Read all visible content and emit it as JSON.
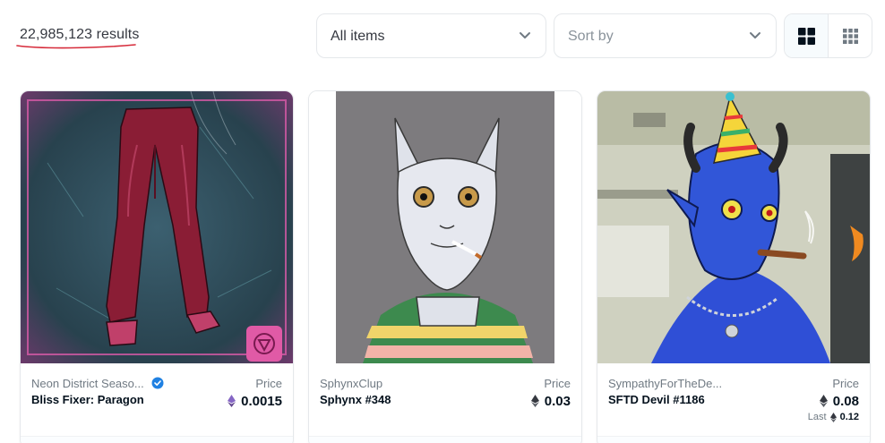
{
  "results": {
    "count_text": "22,985,123 results"
  },
  "filters": {
    "items_select": {
      "value": "All items"
    },
    "sort_select": {
      "placeholder": "Sort by"
    }
  },
  "view_toggle": {
    "options": [
      "large-grid",
      "small-grid"
    ],
    "selected": "large-grid"
  },
  "colors": {
    "accent_underline": "#d62b3a",
    "verified_blue": "#2081e2",
    "eth_purple": "#8566c4",
    "eth_gray": "#353840"
  },
  "cards": [
    {
      "collection": "Neon District Seaso...",
      "verified": true,
      "name": "Bliss Fixer: Paragon",
      "price_label": "Price",
      "price": "0.0015",
      "currency_icon": "eth-purple-icon"
    },
    {
      "collection": "SphynxClup",
      "verified": false,
      "name": "Sphynx #348",
      "price_label": "Price",
      "price": "0.03",
      "currency_icon": "eth-gray-icon"
    },
    {
      "collection": "SympathyForTheDe...",
      "verified": false,
      "name": "SFTD Devil #1186",
      "price_label": "Price",
      "price": "0.08",
      "currency_icon": "eth-gray-icon",
      "last_label": "Last",
      "last_price": "0.12"
    }
  ]
}
